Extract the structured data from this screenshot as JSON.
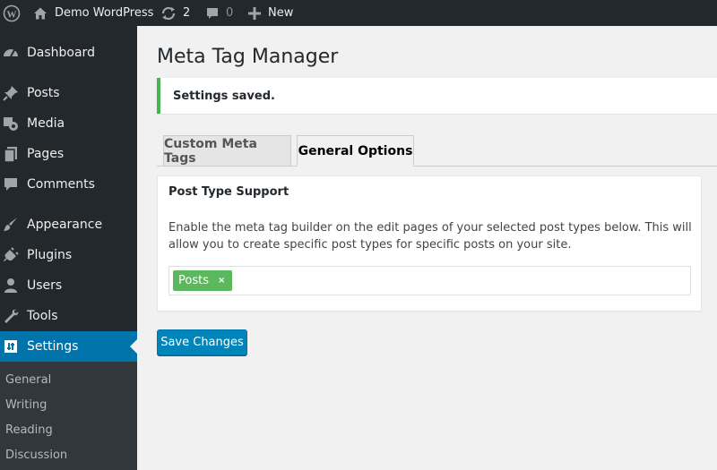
{
  "admin_bar": {
    "site_name": "Demo WordPress",
    "updates_count": "2",
    "comments_count": "0",
    "new_label": "New"
  },
  "sidebar": {
    "items": [
      {
        "label": "Dashboard",
        "icon": "dashboard-icon"
      },
      {
        "label": "Posts",
        "icon": "pin-icon"
      },
      {
        "label": "Media",
        "icon": "media-icon"
      },
      {
        "label": "Pages",
        "icon": "pages-icon"
      },
      {
        "label": "Comments",
        "icon": "comment-icon"
      },
      {
        "label": "Appearance",
        "icon": "brush-icon"
      },
      {
        "label": "Plugins",
        "icon": "plugin-icon"
      },
      {
        "label": "Users",
        "icon": "user-icon"
      },
      {
        "label": "Tools",
        "icon": "wrench-icon"
      },
      {
        "label": "Settings",
        "icon": "settings-icon",
        "current": true
      }
    ],
    "submenu": [
      "General",
      "Writing",
      "Reading",
      "Discussion"
    ]
  },
  "main": {
    "title": "Meta Tag Manager",
    "notice": "Settings saved.",
    "tabs": [
      {
        "label": "Custom Meta Tags",
        "active": false
      },
      {
        "label": "General Options",
        "active": true
      }
    ],
    "panel": {
      "title": "Post Type Support",
      "description": "Enable the meta tag builder on the edit pages of your selected post types below. This will allow you to create specific post types for specific posts on your site.",
      "selected_tags": [
        {
          "label": "Posts",
          "remove": "×"
        }
      ]
    },
    "save_label": "Save Changes"
  },
  "colors": {
    "admin_bg": "#23282d",
    "accent": "#0073aa",
    "button": "#0085ba",
    "success": "#46b450",
    "tag": "#5cb85c"
  }
}
